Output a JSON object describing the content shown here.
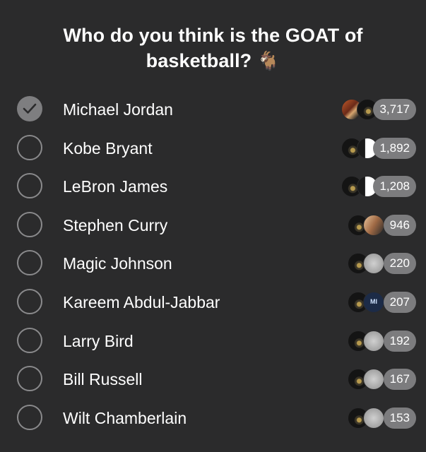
{
  "poll": {
    "question": "Who do you think is the GOAT of basketball?",
    "emoji": "🐐",
    "options": [
      {
        "label": "Michael Jordan",
        "count": "3,717",
        "checked": true
      },
      {
        "label": "Kobe Bryant",
        "count": "1,892",
        "checked": false
      },
      {
        "label": "LeBron James",
        "count": "1,208",
        "checked": false
      },
      {
        "label": "Stephen Curry",
        "count": "946",
        "checked": false
      },
      {
        "label": "Magic Johnson",
        "count": "220",
        "checked": false
      },
      {
        "label": "Kareem Abdul-Jabbar",
        "count": "207",
        "checked": false
      },
      {
        "label": "Larry Bird",
        "count": "192",
        "checked": false
      },
      {
        "label": "Bill Russell",
        "count": "167",
        "checked": false
      },
      {
        "label": "Wilt Chamberlain",
        "count": "153",
        "checked": false
      }
    ],
    "avatar_badge_text": "MI"
  },
  "colors": {
    "background": "#2b2b2c",
    "radio_border": "#8a8a8c",
    "checked_fill": "#7e7e80",
    "count_pill": "#7c7c7e",
    "text": "#ffffff"
  },
  "icons": {
    "checked": "checkmark-icon",
    "unchecked": "radio-circle-icon"
  }
}
